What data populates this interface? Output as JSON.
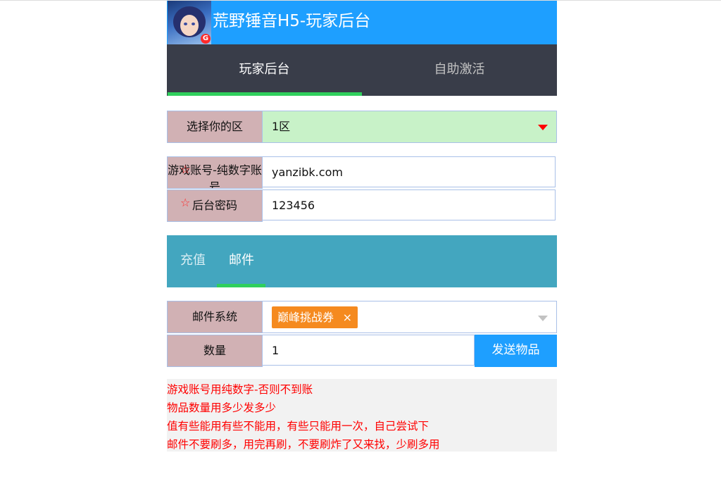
{
  "header": {
    "title": "荒野锤音H5-玩家后台",
    "badge": "G"
  },
  "nav": {
    "tabs": [
      {
        "label": "玩家后台"
      },
      {
        "label": "自助激活"
      }
    ]
  },
  "form": {
    "zone": {
      "label": "选择你的区",
      "value": "1区"
    },
    "account": {
      "label": "游戏账号-纯数字账号",
      "value": "yanzibk.com",
      "star": "☆"
    },
    "password": {
      "label": "后台密码",
      "value": "123456",
      "star": "☆"
    }
  },
  "subnav": {
    "tabs": [
      {
        "label": "充值"
      },
      {
        "label": "邮件"
      }
    ]
  },
  "mail": {
    "label": "邮件系统",
    "tag": "巅峰挑战券",
    "tag_close": "×",
    "quantity_label": "数量",
    "quantity_value": "1",
    "send_label": "发送物品"
  },
  "notes": [
    "游戏账号用纯数字-否则不到账",
    "物品数量用多少发多少",
    "值有些能用有些不能用，有些只能用一次，自己尝试下",
    "邮件不要刷多，用完再刷，不要刷炸了又来找，少刷多用"
  ],
  "colors": {
    "header": "#1e9fff",
    "nav": "#393d49",
    "accent_green": "#2fcf5c",
    "subnav": "#43a6bf",
    "label_bg": "#d1b1b4",
    "tag": "#f58a1f",
    "note_text": "#ff0000"
  }
}
